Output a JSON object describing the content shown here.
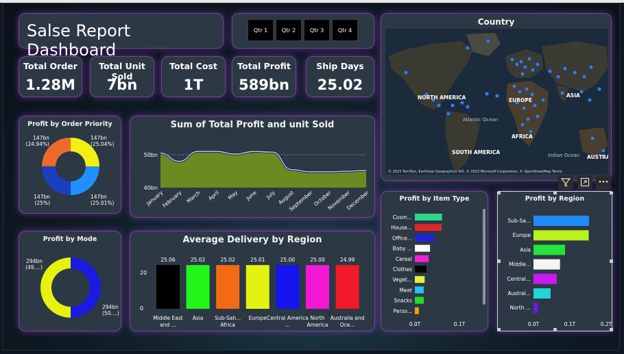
{
  "header": {
    "title": "Salse Report Dashboard"
  },
  "quarters": [
    "Qtr 1",
    "Qtr 2",
    "Qtr 3",
    "Qtr 4"
  ],
  "kpis": [
    {
      "label": "Total Order",
      "value": "1.28M"
    },
    {
      "label": "Total Unit Sold",
      "value": "7bn"
    },
    {
      "label": "Total Cost",
      "value": "1T"
    },
    {
      "label": "Total Profit",
      "value": "589bn"
    },
    {
      "label": "Ship Days",
      "value": "25.02"
    }
  ],
  "map": {
    "title": "Country",
    "labels": [
      "NORTH AMERICA",
      "EUROPE",
      "ASIA",
      "AFRICA",
      "SOUTH AMERICA",
      "Atlantic Ocean",
      "Indian Ocean",
      "AUSTRA"
    ],
    "attribution": "© 2023 TomTom, Earthstar Geographics SIO, © 2023 Microsoft Corporation, © OpenStreetMap  Terms",
    "brand": "Microsoft Bing"
  },
  "profit_priority": {
    "title": "Profit by Order Priority",
    "slices": [
      {
        "label": "147bn",
        "pct": "(25.04%)",
        "value": 25.04,
        "color": "#f2ef16"
      },
      {
        "label": "147bn",
        "pct": "(25.01%)",
        "value": 25.01,
        "color": "#1e90ff"
      },
      {
        "label": "147bn",
        "pct": "(25%)",
        "value": 25.0,
        "color": "#1b3fbd"
      },
      {
        "label": "147bn",
        "pct": "(24.94%)",
        "value": 24.94,
        "color": "#ee6a2a"
      }
    ]
  },
  "profit_mode": {
    "title": "Profit by Mode",
    "slices": [
      {
        "label": "294bn",
        "pct": "(50....)",
        "value": 50.0,
        "color": "#1a1ae0"
      },
      {
        "label": "294bn",
        "pct": "(49....)",
        "value": 50.0,
        "color": "#e6f20f"
      }
    ]
  },
  "line_chart": {
    "title": "Sum of Total Profit and unit Sold",
    "yticks": [
      "50bn",
      "40bn"
    ],
    "months": [
      "January",
      "February",
      "March",
      "April",
      "May",
      "June",
      "July",
      "August",
      "September",
      "October",
      "November",
      "December"
    ],
    "profit_values": [
      50.5,
      48.0,
      51.0,
      51.0,
      50.2,
      51.0,
      50.8,
      45.5,
      44.8,
      44.8,
      45.0,
      45.2
    ]
  },
  "delivery": {
    "title": "Average Delivery by Region",
    "yticks": [
      "20",
      "0"
    ],
    "bars": [
      {
        "label": "Middle East and ...",
        "value": "25.06",
        "color": "#000000"
      },
      {
        "label": "Asia",
        "value": "25.02",
        "color": "#22f51a"
      },
      {
        "label": "Sub-Sah... Africa",
        "value": "25.02",
        "color": "#f46a12"
      },
      {
        "label": "Europe",
        "value": "25.01",
        "color": "#e4f212"
      },
      {
        "label": "Central America ...",
        "value": "25.00",
        "color": "#1414ee"
      },
      {
        "label": "North America",
        "value": "25.00",
        "color": "#f218d4"
      },
      {
        "label": "Australia and Oce...",
        "value": "24.99",
        "color": "#f21a2a"
      }
    ]
  },
  "item_type": {
    "title": "Profit by Item Type",
    "xticks": [
      "0.0T",
      "0.1T"
    ],
    "bars": [
      {
        "label": "Cosm...",
        "value": 0.061,
        "color": "#2bd68a"
      },
      {
        "label": "House...",
        "value": 0.06,
        "color": "#e0282a"
      },
      {
        "label": "Office...",
        "value": 0.044,
        "color": "#2222dd"
      },
      {
        "label": "Baby ...",
        "value": 0.034,
        "color": "#ffffff"
      },
      {
        "label": "Cereal",
        "value": 0.031,
        "color": "#ee22d4"
      },
      {
        "label": "Clothes",
        "value": 0.026,
        "color": "#000000"
      },
      {
        "label": "Veget...",
        "value": 0.022,
        "color": "#e4f23a"
      },
      {
        "label": "Meat",
        "value": 0.02,
        "color": "#22c4f2"
      },
      {
        "label": "Snacks",
        "value": 0.02,
        "color": "#22e022"
      },
      {
        "label": "Perso...",
        "value": 0.009,
        "color": "#f2a012"
      }
    ]
  },
  "region": {
    "title": "Profit by Region",
    "xticks": [
      "0.0T",
      "0.1T",
      "0.2T"
    ],
    "bars": [
      {
        "label": "Sub-Sa...",
        "value": 0.153,
        "color": "#1e8cf2"
      },
      {
        "label": "Europe",
        "value": 0.152,
        "color": "#b8f21a"
      },
      {
        "label": "Asia",
        "value": 0.087,
        "color": "#22e43a"
      },
      {
        "label": "Middle...",
        "value": 0.073,
        "color": "#f5f5f5"
      },
      {
        "label": "Central...",
        "value": 0.064,
        "color": "#c81af2"
      },
      {
        "label": "Austral...",
        "value": 0.047,
        "color": "#22d6d6"
      },
      {
        "label": "North ...",
        "value": 0.012,
        "color": "#6a1ae6"
      }
    ]
  },
  "toolbar": {
    "filter_icon": "filter-icon",
    "focus_icon": "focus-mode-icon",
    "more_label": "···"
  }
}
